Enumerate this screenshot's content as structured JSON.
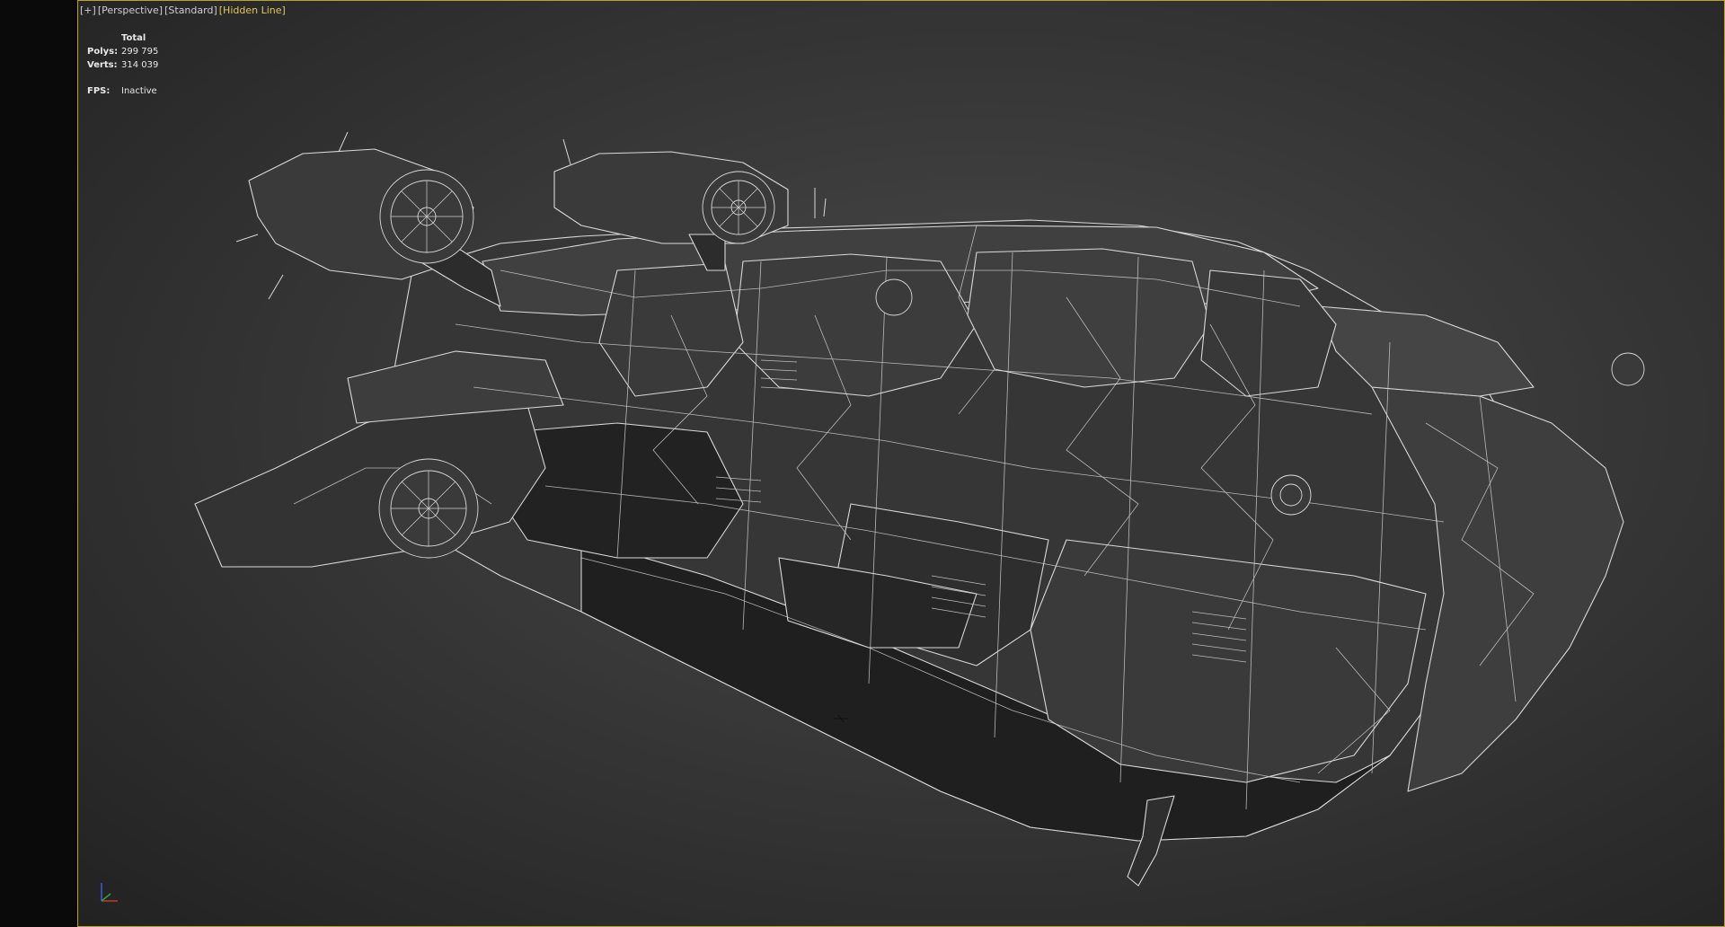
{
  "viewport": {
    "labels": {
      "plus": "[+]",
      "view": "[Perspective]",
      "shading": "[Standard]",
      "mode": "[Hidden Line]"
    },
    "stats": {
      "header": "Total",
      "polys_label": "Polys:",
      "polys_value": "299 795",
      "verts_label": "Verts:",
      "verts_value": "314 039",
      "fps_label": "FPS:",
      "fps_value": "Inactive"
    },
    "colors": {
      "viewport_border": "#b9a32a",
      "active_label": "#e3c55a",
      "wire": "#d8d8d8",
      "hull_dark": "#2b2b2b",
      "hull_mid": "#3b3b3b"
    }
  },
  "icons": {
    "axis": "xyz-axis-icon",
    "cursor": "transform-cursor-icon"
  }
}
